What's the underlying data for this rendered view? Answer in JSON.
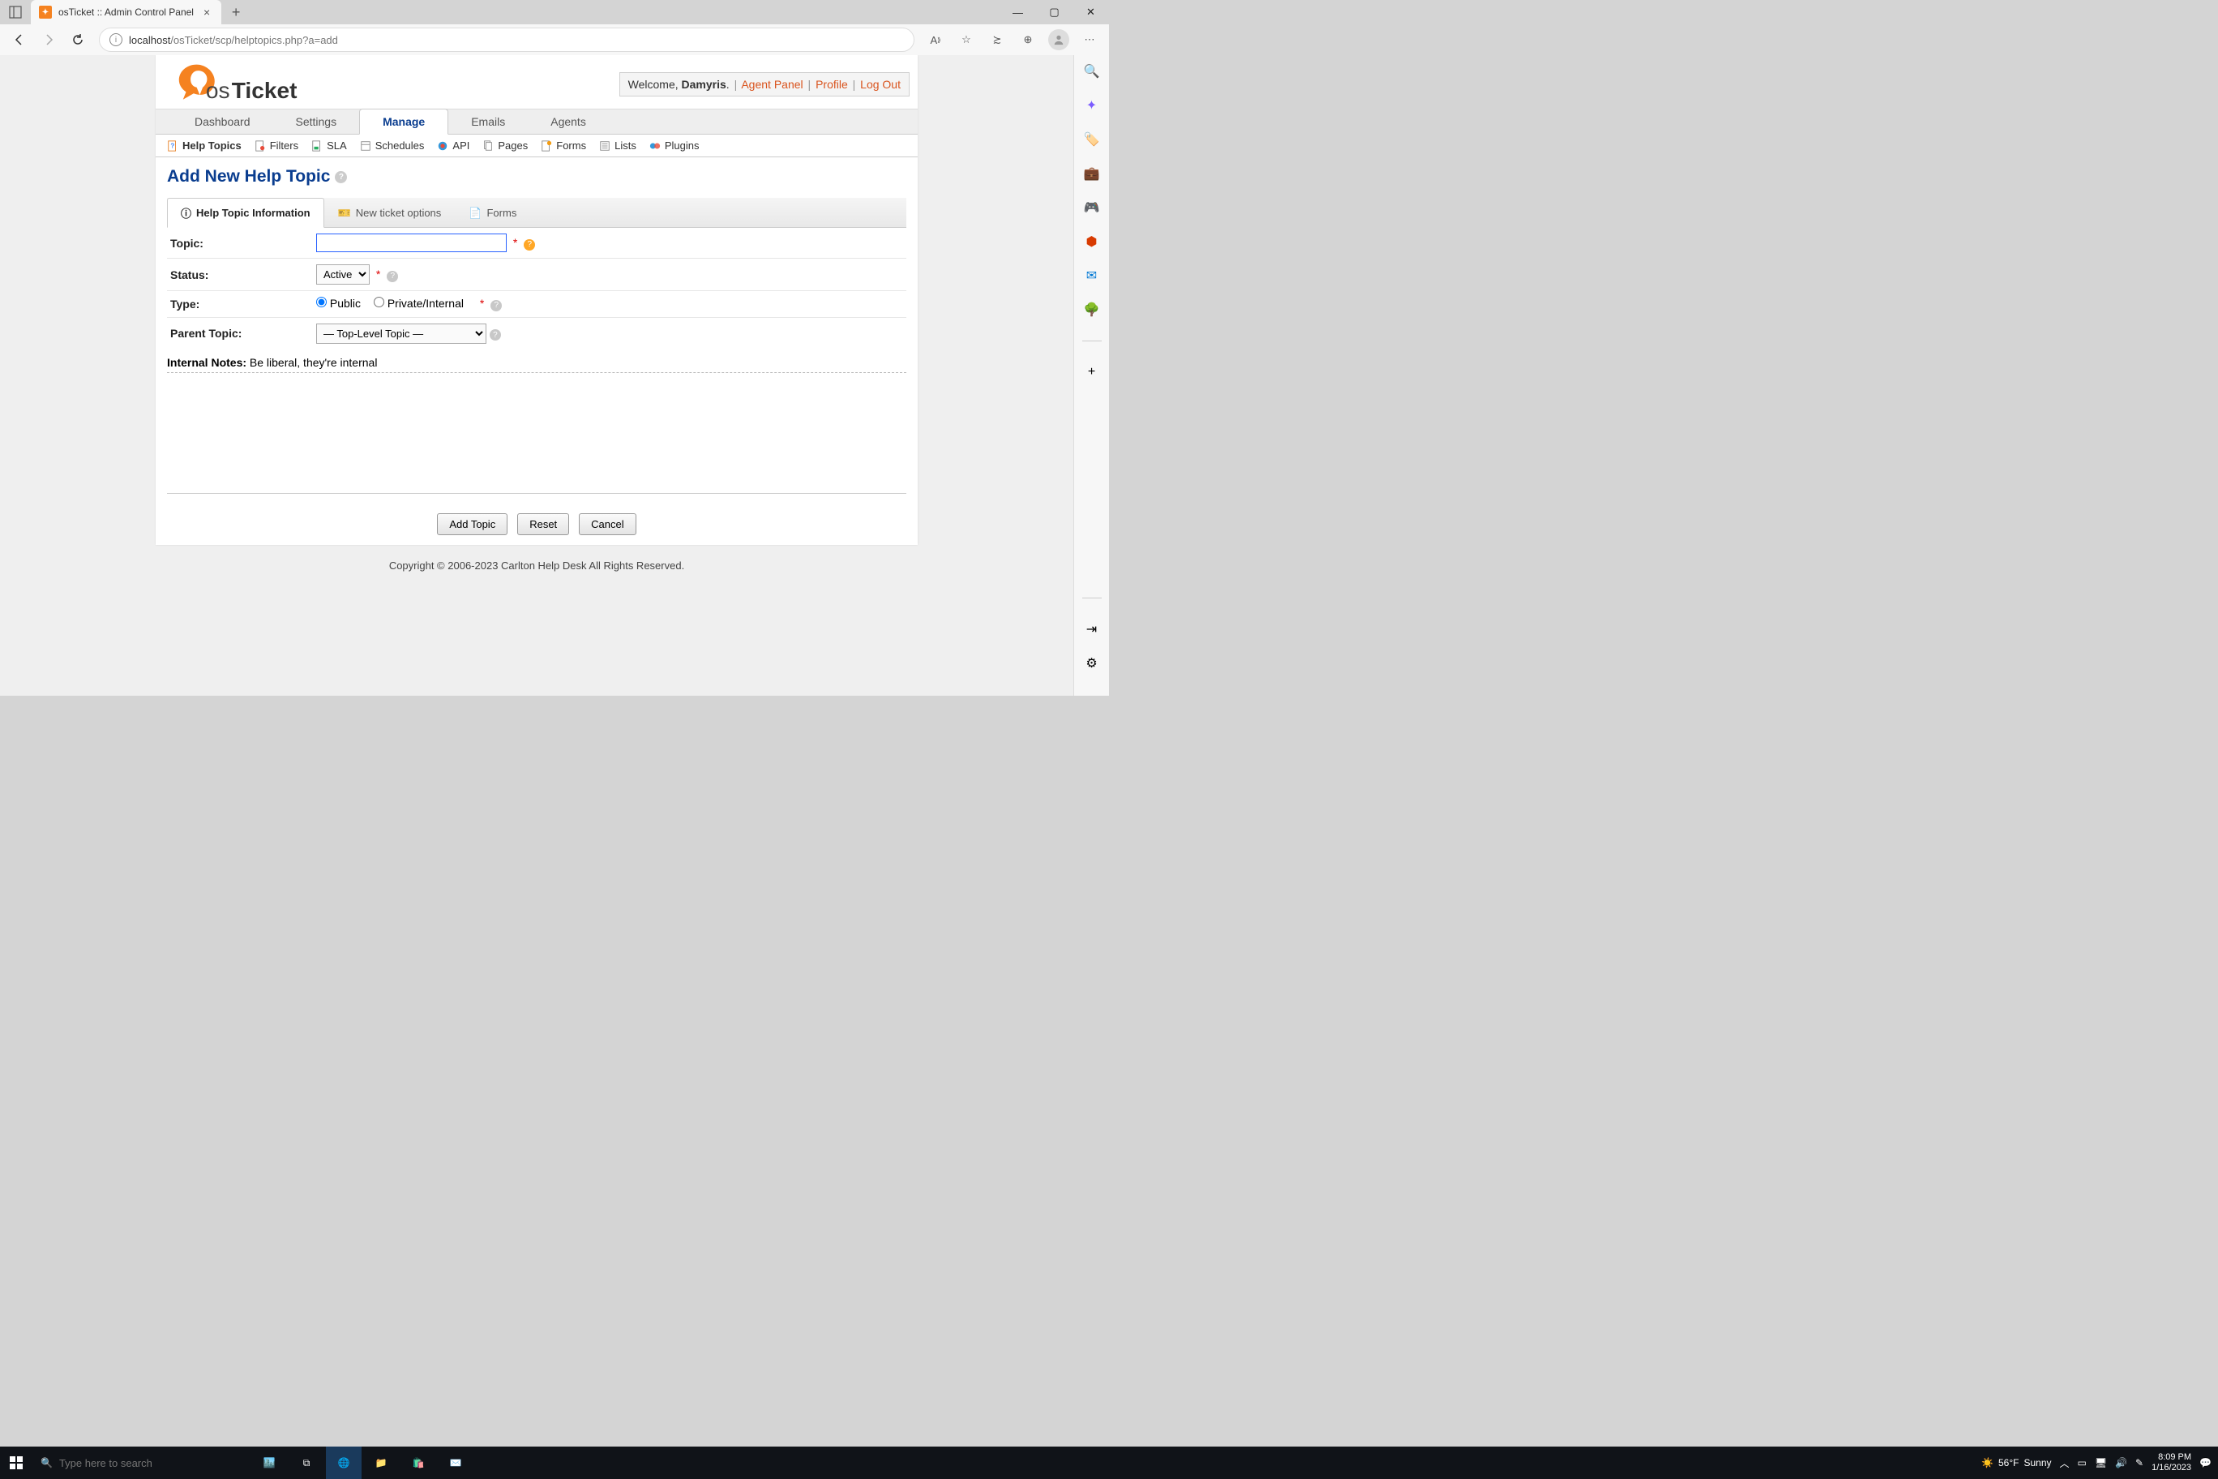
{
  "browser": {
    "tab_title": "osTicket :: Admin Control Panel",
    "url_host": "localhost",
    "url_path": "/osTicket/scp/helptopics.php?a=add"
  },
  "header": {
    "welcome": "Welcome, ",
    "user": "Damyris",
    "agent_panel": "Agent Panel",
    "profile": "Profile",
    "logout": "Log Out"
  },
  "main_tabs": [
    "Dashboard",
    "Settings",
    "Manage",
    "Emails",
    "Agents"
  ],
  "main_tab_active": 2,
  "sub_nav": [
    "Help Topics",
    "Filters",
    "SLA",
    "Schedules",
    "API",
    "Pages",
    "Forms",
    "Lists",
    "Plugins"
  ],
  "sub_nav_active": 0,
  "page_title": "Add New Help Topic",
  "form_tabs": [
    "Help Topic Information",
    "New ticket options",
    "Forms"
  ],
  "form_tab_active": 0,
  "fields": {
    "topic_label": "Topic:",
    "topic_value": "",
    "status_label": "Status:",
    "status_options": [
      "Active"
    ],
    "type_label": "Type:",
    "type_public": "Public",
    "type_private": "Private/Internal",
    "parent_label": "Parent Topic:",
    "parent_options": [
      "— Top-Level Topic —"
    ],
    "notes_label": "Internal Notes:",
    "notes_hint": "Be liberal, they're internal"
  },
  "buttons": {
    "submit": "Add Topic",
    "reset": "Reset",
    "cancel": "Cancel"
  },
  "footer": "Copyright © 2006-2023 Carlton Help Desk All Rights Reserved.",
  "taskbar": {
    "search_placeholder": "Type here to search",
    "weather_temp": "56°F",
    "weather_cond": "Sunny",
    "time": "8:09 PM",
    "date": "1/16/2023"
  }
}
